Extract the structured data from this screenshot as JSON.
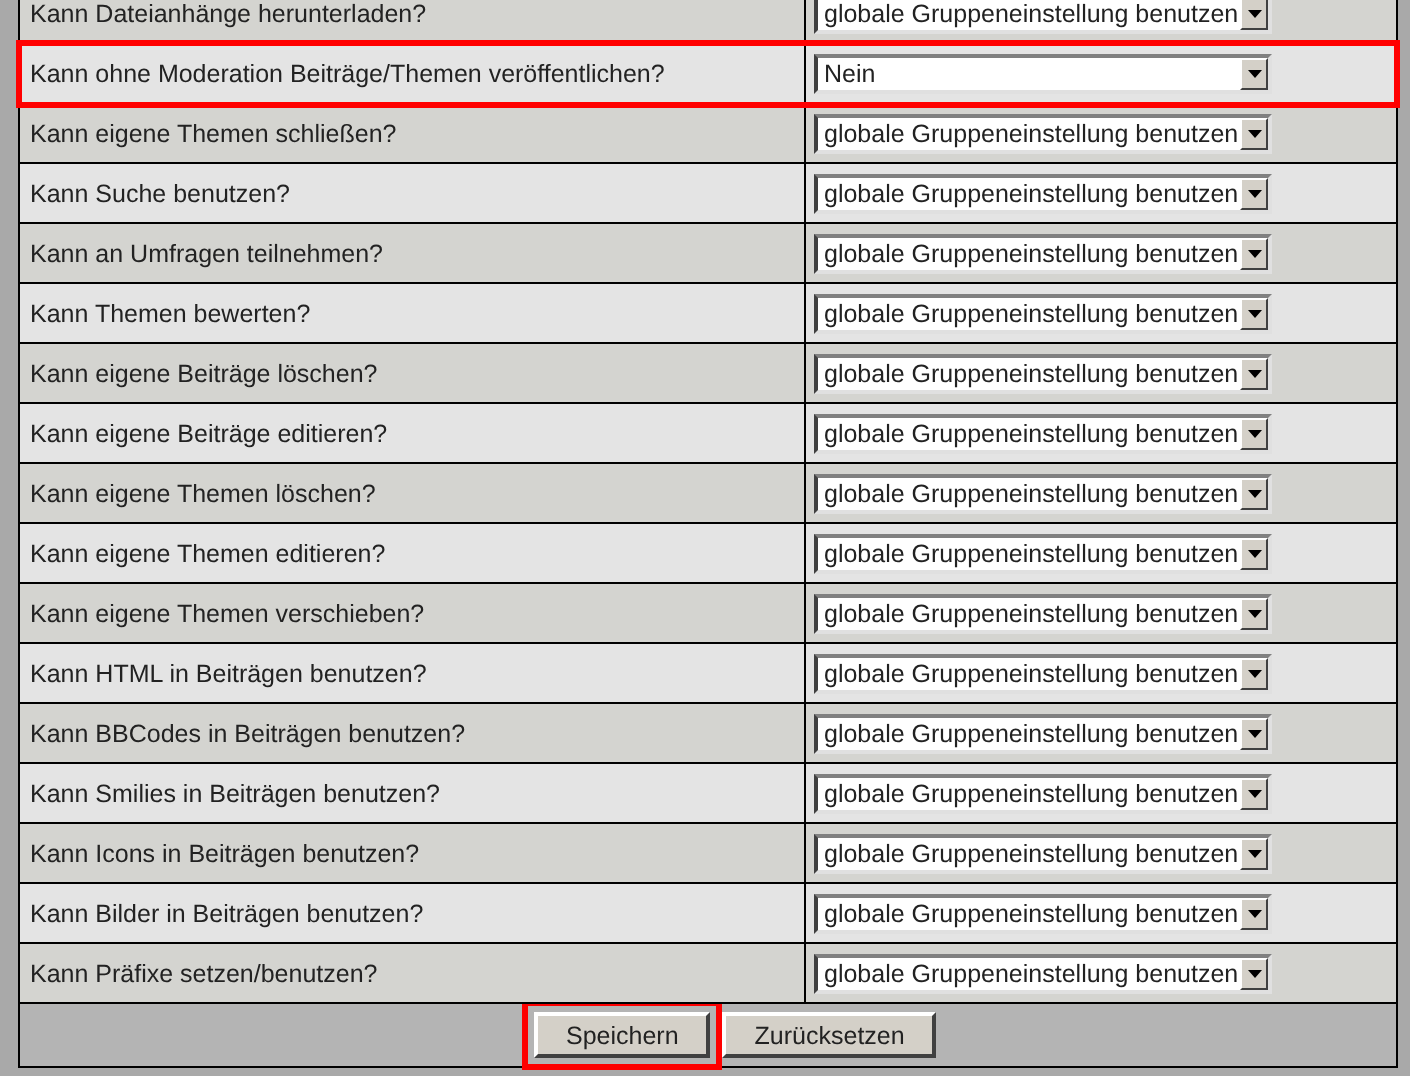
{
  "permissions": [
    {
      "label": "Kann Dateianhänge herunterladen?",
      "value": "globale Gruppeneinstellung benutzen",
      "highlighted": false
    },
    {
      "label": "Kann ohne Moderation Beiträge/Themen veröffentlichen?",
      "value": "Nein",
      "highlighted": true
    },
    {
      "label": "Kann eigene Themen schließen?",
      "value": "globale Gruppeneinstellung benutzen",
      "highlighted": false
    },
    {
      "label": "Kann Suche benutzen?",
      "value": "globale Gruppeneinstellung benutzen",
      "highlighted": false
    },
    {
      "label": "Kann an Umfragen teilnehmen?",
      "value": "globale Gruppeneinstellung benutzen",
      "highlighted": false
    },
    {
      "label": "Kann Themen bewerten?",
      "value": "globale Gruppeneinstellung benutzen",
      "highlighted": false
    },
    {
      "label": "Kann eigene Beiträge löschen?",
      "value": "globale Gruppeneinstellung benutzen",
      "highlighted": false
    },
    {
      "label": "Kann eigene Beiträge editieren?",
      "value": "globale Gruppeneinstellung benutzen",
      "highlighted": false
    },
    {
      "label": "Kann eigene Themen löschen?",
      "value": "globale Gruppeneinstellung benutzen",
      "highlighted": false
    },
    {
      "label": "Kann eigene Themen editieren?",
      "value": "globale Gruppeneinstellung benutzen",
      "highlighted": false
    },
    {
      "label": "Kann eigene Themen verschieben?",
      "value": "globale Gruppeneinstellung benutzen",
      "highlighted": false
    },
    {
      "label": "Kann HTML in Beiträgen benutzen?",
      "value": "globale Gruppeneinstellung benutzen",
      "highlighted": false
    },
    {
      "label": "Kann BBCodes in Beiträgen benutzen?",
      "value": "globale Gruppeneinstellung benutzen",
      "highlighted": false
    },
    {
      "label": "Kann Smilies in Beiträgen benutzen?",
      "value": "globale Gruppeneinstellung benutzen",
      "highlighted": false
    },
    {
      "label": "Kann Icons in Beiträgen benutzen?",
      "value": "globale Gruppeneinstellung benutzen",
      "highlighted": false
    },
    {
      "label": "Kann Bilder in Beiträgen benutzen?",
      "value": "globale Gruppeneinstellung benutzen",
      "highlighted": false
    },
    {
      "label": "Kann Präfixe setzen/benutzen?",
      "value": "globale Gruppeneinstellung benutzen",
      "highlighted": false
    }
  ],
  "buttons": [
    {
      "label": "Speichern",
      "highlighted": true
    },
    {
      "label": "Zurücksetzen",
      "highlighted": false
    }
  ]
}
